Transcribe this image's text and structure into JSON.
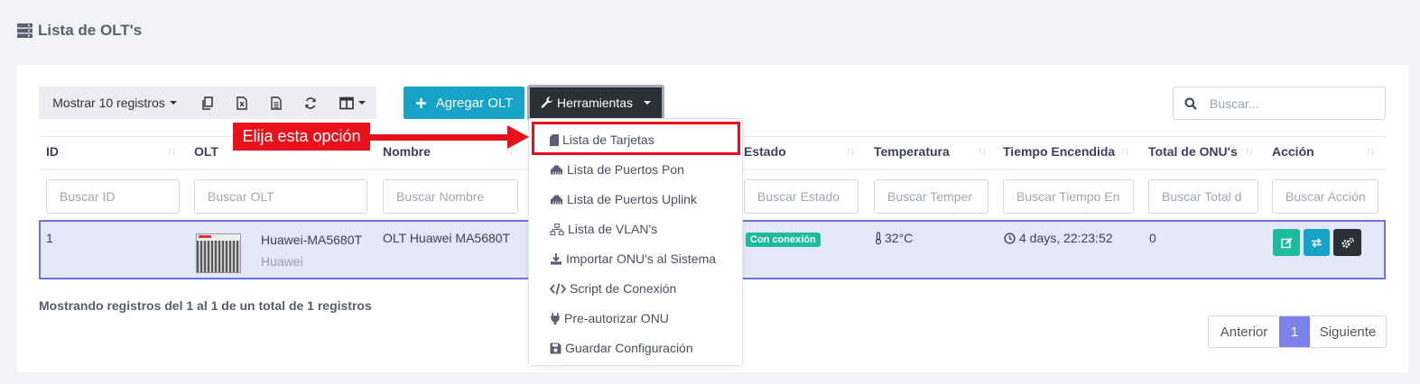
{
  "page": {
    "title": "Lista de OLT's"
  },
  "toolbar": {
    "show_records": "Mostrar 10 registros",
    "add_button": "Agregar OLT",
    "tools_button": "Herramientas",
    "search_placeholder": "Buscar..."
  },
  "table": {
    "columns": [
      "ID",
      "OLT",
      "Nombre",
      "Estado",
      "Temperatura",
      "Tiempo Encendida",
      "Total de ONU's",
      "Acción"
    ],
    "filters": [
      "Buscar ID",
      "Buscar OLT",
      "Buscar Nombre",
      "Buscar Estado",
      "Buscar Temper",
      "Buscar Tiempo En",
      "Buscar Total d",
      "Buscar Acción"
    ],
    "rows": [
      {
        "id": "1",
        "olt_model": "Huawei-MA5680T",
        "olt_brand": "Huawei",
        "name": "OLT Huawei MA5680T",
        "status": "Con conexión",
        "temperature": "32°C",
        "uptime": "4 days, 22:23:52",
        "onu_total": "0"
      }
    ],
    "info": "Mostrando registros del 1 al 1 de un total de 1 registros"
  },
  "pagination": {
    "prev": "Anterior",
    "current": "1",
    "next": "Siguiente"
  },
  "dropdown": {
    "items": [
      {
        "label": "Lista de Tarjetas",
        "icon": "sd-card-icon"
      },
      {
        "label": "Lista de Puertos Pon",
        "icon": "ethernet-icon"
      },
      {
        "label": "Lista de Puertos Uplink",
        "icon": "ethernet-icon"
      },
      {
        "label": "Lista de VLAN's",
        "icon": "network-icon"
      },
      {
        "label": "Importar ONU's al Sistema",
        "icon": "download-icon"
      },
      {
        "label": "Script de Conexión",
        "icon": "code-icon"
      },
      {
        "label": "Pre-autorizar ONU",
        "icon": "plug-icon"
      },
      {
        "label": "Guardar Configuración",
        "icon": "save-icon"
      }
    ]
  },
  "annotation": {
    "callout": "Elija esta opción"
  },
  "colors": {
    "primary": "#17a2c8",
    "dark": "#2b2f36",
    "success": "#1abc9c",
    "accent": "#7c82e8",
    "annotation": "#e8101a"
  }
}
